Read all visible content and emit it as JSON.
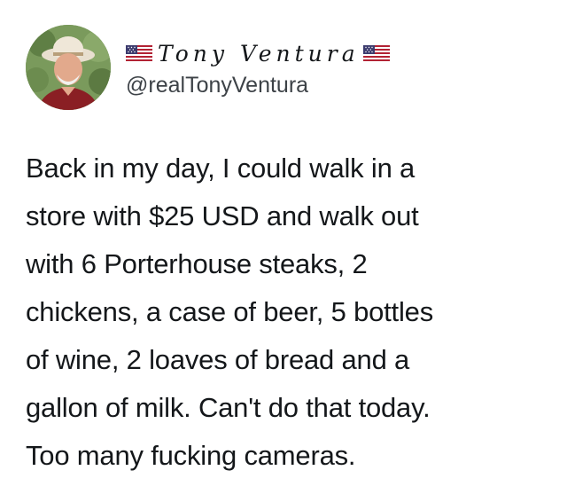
{
  "tweet": {
    "author": {
      "display_name": "Tony Ventura",
      "handle": "@realTonyVentura",
      "flag_icon_left": "us-flag-icon",
      "flag_icon_right": "us-flag-icon"
    },
    "lines": [
      "Back in my day, I could walk in a",
      "store with $25 USD and walk out",
      "with 6 Porterhouse steaks, 2",
      "chickens, a case of beer, 5 bottles",
      "of wine, 2 loaves of bread and a",
      "gallon of milk. Can't do that today.",
      "Too many fucking cameras."
    ]
  }
}
